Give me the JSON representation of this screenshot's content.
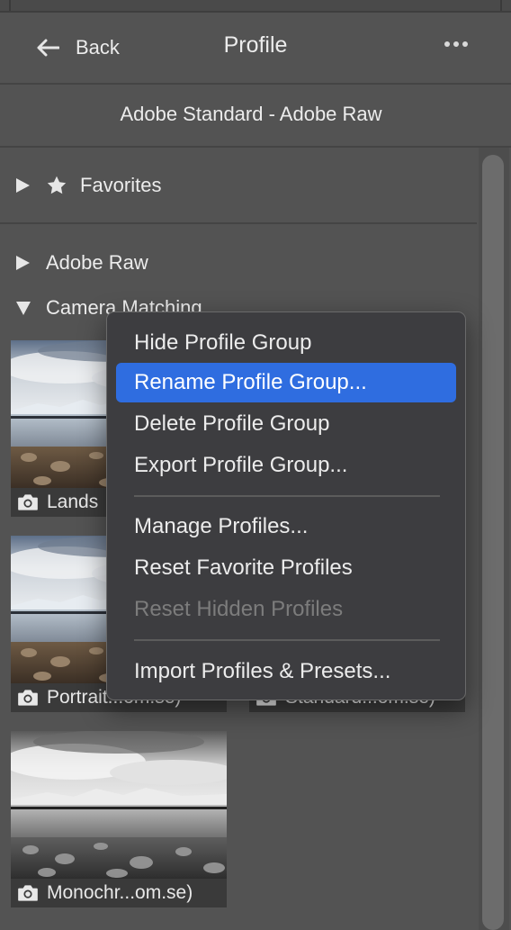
{
  "header": {
    "back_label": "Back",
    "title": "Profile"
  },
  "current_profile": "Adobe Standard - Adobe Raw",
  "groups": {
    "favorites": "Favorites",
    "adobe_raw": "Adobe Raw",
    "camera_matching": "Camera Matching"
  },
  "thumbnails": [
    {
      "caption": "Lands",
      "style": "color"
    },
    {
      "caption": "Portrait...om.se)",
      "style": "color"
    },
    {
      "caption": "Standard...om.se)",
      "style": "color"
    },
    {
      "caption": "Monochr...om.se)",
      "style": "mono"
    }
  ],
  "context_menu": {
    "items": [
      {
        "label": "Hide Profile Group",
        "state": "normal"
      },
      {
        "label": "Rename Profile Group...",
        "state": "highlighted"
      },
      {
        "label": "Delete Profile Group",
        "state": "normal"
      },
      {
        "label": "Export Profile Group...",
        "state": "normal"
      },
      {
        "label": "Manage Profiles...",
        "state": "normal"
      },
      {
        "label": "Reset Favorite Profiles",
        "state": "normal"
      },
      {
        "label": "Reset Hidden Profiles",
        "state": "disabled"
      },
      {
        "label": "Import Profiles & Presets...",
        "state": "normal"
      }
    ]
  },
  "colors": {
    "panel_bg": "#535353",
    "menu_bg": "#3d3d40",
    "highlight": "#2f6de0",
    "disabled_text": "#7c7c7c"
  },
  "icons": [
    "back-arrow-icon",
    "more-options-icon",
    "star-icon",
    "expand-triangle-icon",
    "collapse-triangle-icon",
    "camera-icon"
  ]
}
